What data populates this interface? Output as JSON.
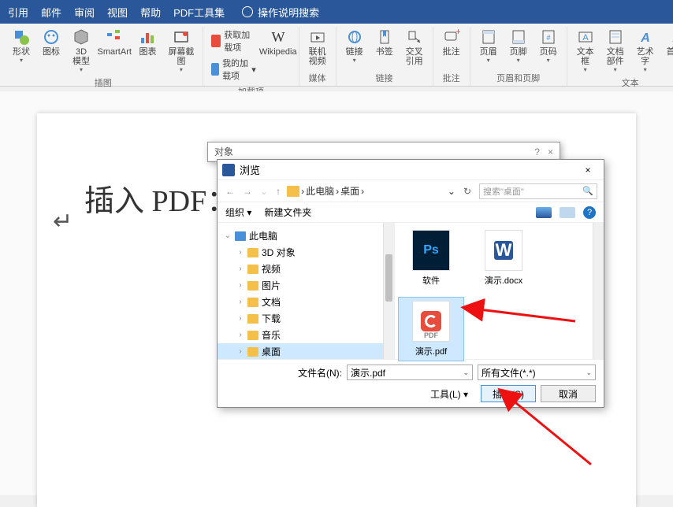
{
  "menu": {
    "items": [
      "引用",
      "邮件",
      "审阅",
      "视图",
      "帮助",
      "PDF工具集"
    ],
    "help_search": "操作说明搜索"
  },
  "ribbon": {
    "g1": {
      "shapes": "形状",
      "icons": "图标",
      "model3d": "3D\n模型",
      "smartart": "SmartArt",
      "chart": "图表",
      "screenshot": "屏幕截图",
      "label": "插图"
    },
    "g2": {
      "getaddins": "获取加载项",
      "myaddins": "我的加载项",
      "wikipedia": "Wikipedia",
      "label": "加载项"
    },
    "g3": {
      "video": "联机视频",
      "label": "媒体"
    },
    "g4": {
      "link": "链接",
      "bookmark": "书签",
      "crossref": "交叉引用",
      "label": "链接"
    },
    "g5": {
      "comment": "批注",
      "label": "批注"
    },
    "g6": {
      "header": "页眉",
      "footer": "页脚",
      "pagenum": "页码",
      "label": "页眉和页脚"
    },
    "g7": {
      "textbox": "文本框",
      "parts": "文档部件",
      "wordart": "艺术字",
      "dropcap": "首字",
      "label": "文本"
    }
  },
  "document": {
    "text": "插入 PDF："
  },
  "obj_dialog": {
    "title": "对象",
    "help": "?",
    "close": "×"
  },
  "browse": {
    "title": "浏览",
    "close": "×",
    "nav": {
      "back": "←",
      "fwd": "→",
      "up": "↑",
      "path_items": [
        "此电脑",
        "桌面"
      ],
      "path_sep": "›",
      "dropdown": "⌄",
      "refresh": "↻",
      "search_placeholder": "搜索\"桌面\"",
      "search_icon": "🔍"
    },
    "toolbar": {
      "organize": "组织 ▾",
      "newfolder": "新建文件夹",
      "help": "?"
    },
    "tree": {
      "thispc": "此电脑",
      "items": [
        "3D 对象",
        "视频",
        "图片",
        "文档",
        "下载",
        "音乐",
        "桌面"
      ]
    },
    "files": {
      "f1": "软件",
      "f2": "演示.docx",
      "f3": "演示.pdf"
    },
    "bottom": {
      "filename_label": "文件名(N):",
      "filename_value": "演示.pdf",
      "filetype": "所有文件(*.*)",
      "tools": "工具(L)  ▾",
      "insert": "插入(S)",
      "cancel": "取消"
    }
  }
}
